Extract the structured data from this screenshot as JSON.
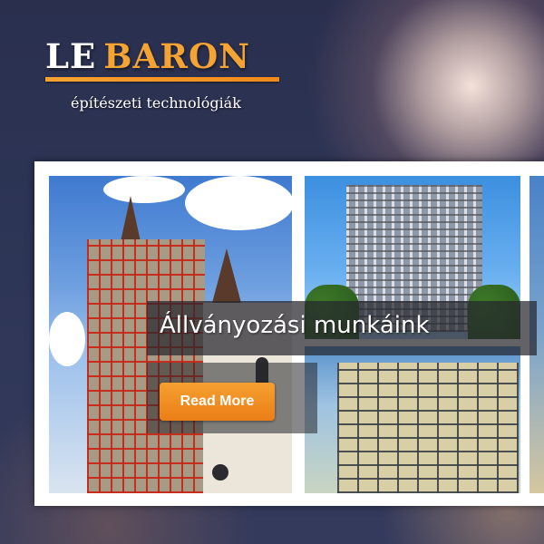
{
  "header": {
    "logo_part1": "LE",
    "logo_part2": "BARON",
    "tagline": "építészeti technológiák"
  },
  "slider": {
    "caption_title": "Állványozási munkáink",
    "read_more_label": "Read More"
  },
  "colors": {
    "accent": "#f5a332",
    "button": "#ef8a1f",
    "background": "#2d3556"
  }
}
